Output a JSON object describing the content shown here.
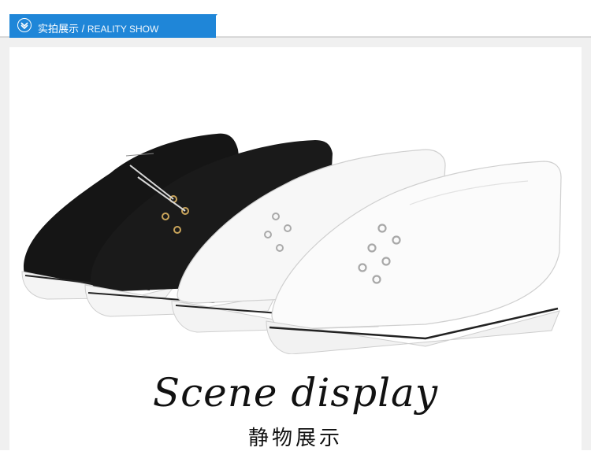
{
  "header": {
    "title_cn": "实拍展示",
    "separator": " / ",
    "title_en": "REALITY SHOW",
    "accent_color": "#1f86d8",
    "icon": "chevron-down-circle-icon"
  },
  "showcase": {
    "title": "Scene display",
    "subtitle": "静物展示"
  }
}
